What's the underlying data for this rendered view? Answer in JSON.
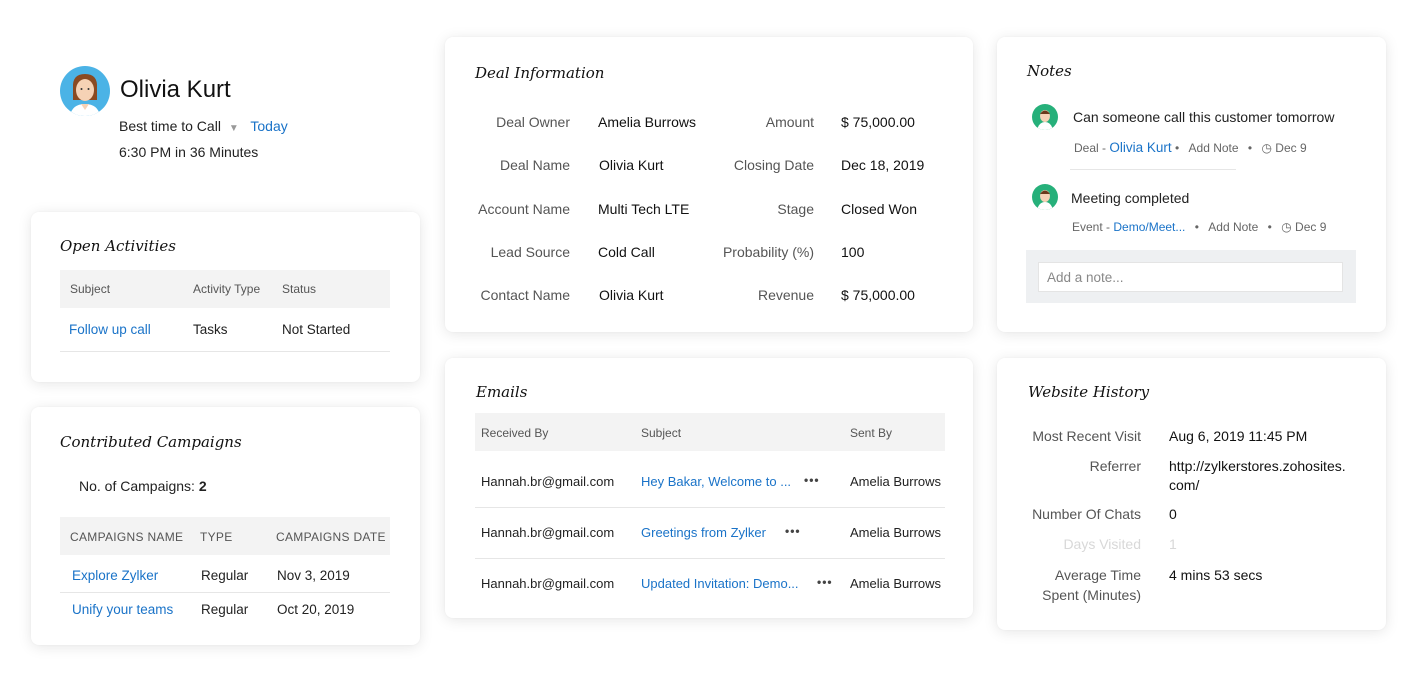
{
  "profile": {
    "name": "Olivia Kurt",
    "best_time_label": "Best time to Call",
    "best_time_value": "Today",
    "time_info": "6:30 PM in 36 Minutes"
  },
  "open_activities": {
    "title": "Open Activities",
    "headers": [
      "Subject",
      "Activity Type",
      "Status"
    ],
    "rows": [
      {
        "subject": "Follow up call",
        "type": "Tasks",
        "status": "Not Started"
      }
    ]
  },
  "campaigns": {
    "title": "Contributed Campaigns",
    "count_label": "No. of Campaigns:",
    "count_value": "2",
    "headers": [
      "CAMPAIGNS NAME",
      "TYPE",
      "CAMPAIGNS DATE"
    ],
    "rows": [
      {
        "name": "Explore Zylker",
        "type": "Regular",
        "date": "Nov 3, 2019"
      },
      {
        "name": "Unify your teams",
        "type": "Regular",
        "date": "Oct 20, 2019"
      }
    ]
  },
  "deal": {
    "title": "Deal Information",
    "left": [
      {
        "label": "Deal Owner",
        "value": "Amelia Burrows"
      },
      {
        "label": "Deal Name",
        "value": "Olivia Kurt"
      },
      {
        "label": "Account Name",
        "value": "Multi Tech LTE"
      },
      {
        "label": "Lead Source",
        "value": "Cold Call"
      },
      {
        "label": "Contact Name",
        "value": "Olivia Kurt"
      }
    ],
    "right": [
      {
        "label": "Amount",
        "value": "$ 75,000.00"
      },
      {
        "label": "Closing Date",
        "value": "Dec 18, 2019"
      },
      {
        "label": "Stage",
        "value": "Closed Won"
      },
      {
        "label": "Probability (%)",
        "value": "100"
      },
      {
        "label": "Revenue",
        "value": "$ 75,000.00"
      }
    ]
  },
  "emails": {
    "title": "Emails",
    "headers": [
      "Received By",
      "Subject",
      "Sent By"
    ],
    "rows": [
      {
        "received": "Hannah.br@gmail.com",
        "subject": "Hey Bakar, Welcome to ...",
        "sent": "Amelia Burrows"
      },
      {
        "received": "Hannah.br@gmail.com",
        "subject": "Greetings from Zylker",
        "sent": "Amelia Burrows"
      },
      {
        "received": "Hannah.br@gmail.com",
        "subject": "Updated Invitation: Demo...",
        "sent": "Amelia Burrows"
      }
    ],
    "more": "•••"
  },
  "notes": {
    "title": "Notes",
    "items": [
      {
        "text": "Can someone call this customer tomorrow",
        "kind": "Deal -",
        "ref": "Olivia Kurt",
        "add": "Add Note",
        "date": "Dec 9"
      },
      {
        "text": "Meeting completed",
        "kind": "Event -",
        "ref": "Demo/Meet...",
        "add": "Add Note",
        "date": "Dec 9"
      }
    ],
    "placeholder": "Add a note..."
  },
  "website": {
    "title": "Website History",
    "rows": [
      {
        "label": "Most Recent Visit",
        "value": "Aug 6, 2019 11:45 PM"
      },
      {
        "label": "Referrer",
        "value": "http://zylkerstores.zohosites.",
        "value2": "com/"
      },
      {
        "label": "Number Of Chats",
        "value": "0"
      },
      {
        "label": "Days Visited",
        "value": "1"
      },
      {
        "label": "Average Time",
        "label2": "Spent (Minutes)",
        "value": "4 mins 53 secs"
      }
    ]
  },
  "colors": {
    "accent": "#1a73c8",
    "avatar_bg": "#4bb3e6",
    "note_avatar_bg": "#26b07a"
  }
}
